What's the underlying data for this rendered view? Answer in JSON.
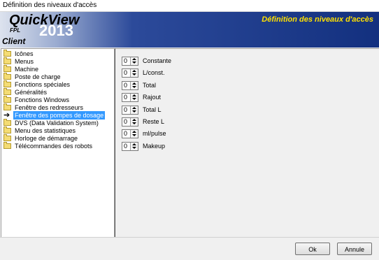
{
  "window": {
    "title": "Définition des niveaux d'accès"
  },
  "banner": {
    "brand": "QuickView",
    "year": "2013",
    "sub": "FPL",
    "client": "Client",
    "title": "Définition des niveaux d'accès"
  },
  "tree": {
    "items": [
      {
        "label": "Icônes",
        "icon": "folder-icon",
        "selected": false
      },
      {
        "label": "Menus",
        "icon": "folder-icon",
        "selected": false
      },
      {
        "label": "Machine",
        "icon": "folder-icon",
        "selected": false
      },
      {
        "label": "Poste de charge",
        "icon": "folder-icon",
        "selected": false
      },
      {
        "label": "Fonctions spéciales",
        "icon": "folder-icon",
        "selected": false
      },
      {
        "label": "Généralités",
        "icon": "folder-icon",
        "selected": false
      },
      {
        "label": "Fonctions Windows",
        "icon": "folder-icon",
        "selected": false
      },
      {
        "label": "Fenêtre des redresseurs",
        "icon": "folder-icon",
        "selected": false
      },
      {
        "label": "Fenêtre des pompes de dosage",
        "icon": "arrow-icon",
        "selected": true
      },
      {
        "label": "DVS (Data Validation System)",
        "icon": "folder-icon",
        "selected": false
      },
      {
        "label": "Menu des statistiques",
        "icon": "folder-icon",
        "selected": false
      },
      {
        "label": "Horloge de démarrage",
        "icon": "folder-icon",
        "selected": false
      },
      {
        "label": "Télécommandes des robots",
        "icon": "folder-icon",
        "selected": false
      }
    ]
  },
  "fields": [
    {
      "label": "Constante",
      "value": "0"
    },
    {
      "label": "L/const.",
      "value": "0"
    },
    {
      "label": "Total",
      "value": "0"
    },
    {
      "label": "Rajout",
      "value": "0"
    },
    {
      "label": "Total L",
      "value": "0"
    },
    {
      "label": "Reste L",
      "value": "0"
    },
    {
      "label": "ml/pulse",
      "value": "0"
    },
    {
      "label": "Makeup",
      "value": "0"
    }
  ],
  "buttons": {
    "ok": "Ok",
    "cancel": "Annule"
  }
}
